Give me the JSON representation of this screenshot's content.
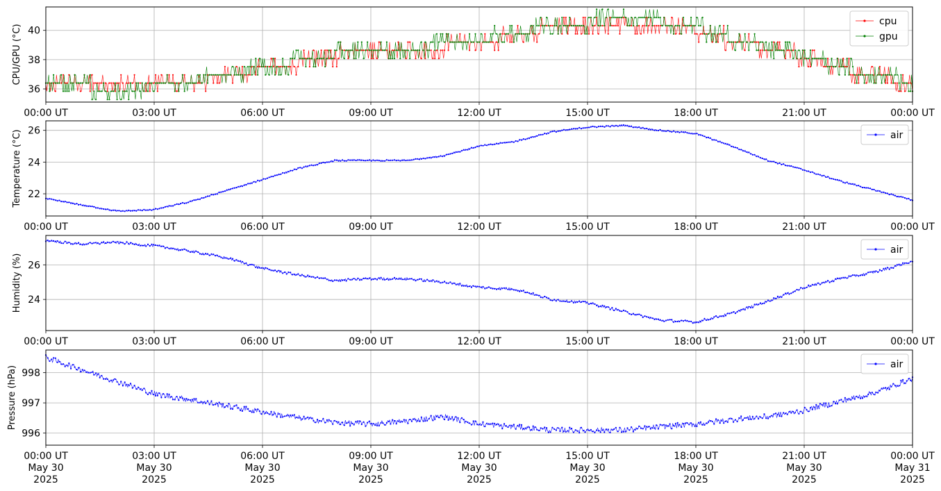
{
  "chart_data": [
    {
      "type": "line",
      "id": "cpu_gpu",
      "ylabel": "CPU/GPU (°C)",
      "xlim": [
        0,
        24
      ],
      "ylim": [
        35.1,
        41.6
      ],
      "yticks": [
        36,
        38,
        40
      ],
      "grid": true,
      "legend": "top-right",
      "series": [
        {
          "name": "cpu",
          "color": "#ff0000",
          "x": [
            0,
            1,
            2,
            3,
            4,
            5,
            6,
            7,
            8,
            9,
            10,
            11,
            12,
            13,
            14,
            15,
            16,
            17,
            18,
            19,
            20,
            21,
            22,
            23,
            24
          ],
          "y": [
            36.5,
            36.3,
            36.2,
            36.3,
            36.5,
            36.9,
            37.4,
            37.8,
            38.3,
            38.7,
            38.8,
            38.9,
            39.2,
            39.7,
            40.2,
            40.5,
            40.6,
            40.5,
            40.1,
            39.3,
            38.8,
            38.2,
            37.4,
            36.8,
            36.5
          ]
        },
        {
          "name": "gpu",
          "color": "#008000",
          "x": [
            0,
            1,
            2,
            3,
            4,
            5,
            6,
            7,
            8,
            9,
            10,
            11,
            12,
            13,
            14,
            15,
            16,
            17,
            18,
            19,
            20,
            21,
            22,
            23,
            24
          ],
          "y": [
            36.6,
            36.2,
            35.9,
            36.2,
            36.5,
            37.0,
            37.5,
            37.9,
            38.4,
            38.7,
            38.8,
            39.0,
            39.3,
            39.8,
            40.3,
            40.6,
            40.8,
            40.6,
            40.2,
            39.4,
            38.9,
            38.3,
            37.5,
            36.8,
            36.6
          ]
        }
      ]
    },
    {
      "type": "line",
      "id": "temperature",
      "ylabel": "Temperature (°C)",
      "xlim": [
        0,
        24
      ],
      "ylim": [
        20.6,
        26.6
      ],
      "yticks": [
        22,
        24,
        26
      ],
      "grid": true,
      "legend": "top-right",
      "series": [
        {
          "name": "air",
          "color": "#0000ff",
          "x": [
            0,
            1,
            2,
            3,
            4,
            5,
            6,
            7,
            8,
            9,
            10,
            11,
            12,
            13,
            14,
            15,
            16,
            17,
            18,
            19,
            20,
            21,
            22,
            23,
            24
          ],
          "y": [
            21.7,
            21.3,
            20.9,
            21.0,
            21.5,
            22.2,
            22.9,
            23.6,
            24.1,
            24.1,
            24.1,
            24.4,
            25.0,
            25.3,
            25.9,
            26.2,
            26.3,
            26.0,
            25.8,
            25.0,
            24.1,
            23.5,
            22.8,
            22.2,
            21.6
          ]
        }
      ]
    },
    {
      "type": "line",
      "id": "humidity",
      "ylabel": "Humidity (%)",
      "xlim": [
        0,
        24
      ],
      "ylim": [
        22.2,
        27.7
      ],
      "yticks": [
        24,
        26
      ],
      "grid": true,
      "legend": "top-right",
      "series": [
        {
          "name": "air",
          "color": "#0000ff",
          "x": [
            0,
            1,
            2,
            3,
            4,
            5,
            6,
            7,
            8,
            9,
            10,
            11,
            12,
            13,
            14,
            15,
            16,
            17,
            18,
            19,
            20,
            21,
            22,
            23,
            24
          ],
          "y": [
            27.4,
            27.2,
            27.3,
            27.1,
            26.8,
            26.4,
            25.8,
            25.4,
            25.1,
            25.2,
            25.2,
            25.0,
            24.7,
            24.6,
            24.0,
            23.8,
            23.3,
            22.8,
            22.7,
            23.2,
            23.9,
            24.7,
            25.2,
            25.6,
            26.2
          ]
        }
      ]
    },
    {
      "type": "line",
      "id": "pressure",
      "ylabel": "Pressure (hPa)",
      "xlim": [
        0,
        24
      ],
      "ylim": [
        995.6,
        998.75
      ],
      "yticks": [
        996,
        997,
        998
      ],
      "grid": true,
      "legend": "top-right",
      "series": [
        {
          "name": "air",
          "color": "#0000ff",
          "x": [
            0,
            1,
            2,
            3,
            4,
            5,
            6,
            7,
            8,
            9,
            10,
            11,
            12,
            13,
            14,
            15,
            16,
            17,
            18,
            19,
            20,
            21,
            22,
            23,
            24
          ],
          "y": [
            998.5,
            998.1,
            997.7,
            997.3,
            997.1,
            996.9,
            996.7,
            996.5,
            996.35,
            996.3,
            996.4,
            996.55,
            996.3,
            996.2,
            996.1,
            996.1,
            996.1,
            996.2,
            996.3,
            996.45,
            996.55,
            996.75,
            997.05,
            997.35,
            997.8
          ]
        }
      ]
    }
  ],
  "x_tick_labels": [
    "00:00 UT",
    "03:00 UT",
    "06:00 UT",
    "09:00 UT",
    "12:00 UT",
    "15:00 UT",
    "18:00 UT",
    "21:00 UT",
    "00:00 UT"
  ],
  "x_tick_dates": [
    "May 30",
    "May 30",
    "May 30",
    "May 30",
    "May 30",
    "May 30",
    "May 30",
    "May 30",
    "May 31"
  ],
  "x_tick_years": [
    "2025",
    "2025",
    "2025",
    "2025",
    "2025",
    "2025",
    "2025",
    "2025",
    "2025"
  ]
}
